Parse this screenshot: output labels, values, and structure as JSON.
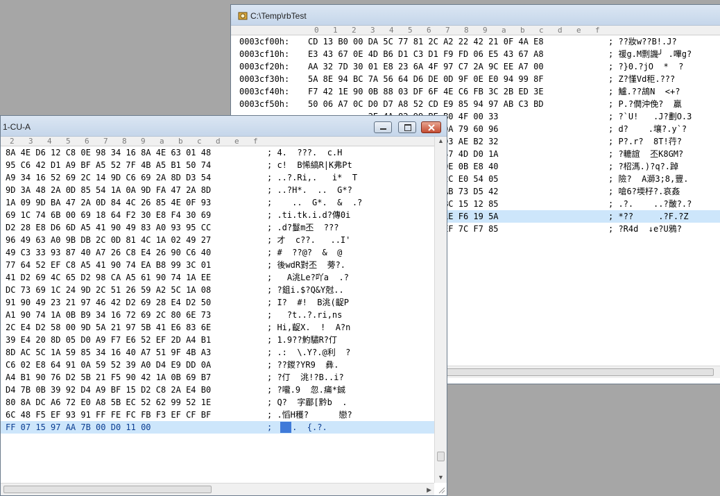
{
  "header_cols": [
    "0",
    "1",
    "2",
    "3",
    "4",
    "5",
    "6",
    "7",
    "8",
    "9",
    "a",
    "b",
    "c",
    "d",
    "e",
    "f"
  ],
  "back_window": {
    "title": "C:\\Temp\\rbTest",
    "rows": [
      {
        "off": "0003cf00h:",
        "hex": "CD 13 B0 00 DA 5C 77 81 2C A2 22 42 21 0F 4A E8",
        "txt": "; ??妝w??B!.J?"
      },
      {
        "off": "0003cf10h:",
        "hex": "E3 43 67 0E 4D B6 D1 C3 D1 F9 FD 06 E5 43 67 A8",
        "txt": "; 禐g.M剽譏╯ .嗶g?"
      },
      {
        "off": "0003cf20h:",
        "hex": "AA 32 7D 30 01 E8 23 6A 4F 97 C7 2A 9C EE A7 00",
        "txt": "; ?}0.?jO  *  ?"
      },
      {
        "off": "0003cf30h:",
        "hex": "5A 8E 94 BC 7A 56 64 D6 DE 0D 9F 0E E0 94 99 8F",
        "txt": "; Z?慬Vd秬.???"
      },
      {
        "off": "0003cf40h:",
        "hex": "F7 42 1E 90 0B 88 03 DF 6F 4E C6 FB 3C 2B ED 3E",
        "txt": "; 鱸.??鴣N  <+?"
      },
      {
        "off": "0003cf50h:",
        "hex": "50 06 A7 0C D0 D7 A8 52 CD E9 85 94 97 AB C3 BD",
        "txt": "; P.?僩沖俛?  贏"
      },
      {
        "off": "",
        "hex": "            2E 4A 82 99 BE B0 4F 00 33",
        "txt": "; ?`U!   .J?劃O.3"
      },
      {
        "off": "",
        "hex": "            11 E9 49 F5 23 0A 79 60 96",
        "txt": "; d?    .壤?.y`?"
      },
      {
        "off": "",
        "hex": "            00 B9 38 54 21 D3 AE B2 32",
        "txt": "; P?.r?  8T!荇?"
      },
      {
        "off": "",
        "hex": "            83 A5 41 4B 38 47 4D D0 1A",
        "txt": "; ?轆誼  丕K8GM?"
      },
      {
        "off": "",
        "hex": "            59 89 38 71 A1 0E 0B E8 40",
        "txt": "; ?柖溤.)?q?.踔"
      },
      {
        "off": "",
        "hex": "            A9 ED 33 3B 38 2C E0 54 05",
        "txt": "; 險?  A溮3;8,豐."
      },
      {
        "off": "",
        "hex": "            5D 45 86 04 1C AB 73 D5 42",
        "txt": "; 嗆6?堧杍?.哀姦"
      },
      {
        "off": "",
        "hex": "            10 CF 8E F0 52 BC 15 12 85",
        "txt": "; .?.    ..?皾?.?"
      },
      {
        "off": "",
        "hex": "            B0 15 ED 23 46 1E F6 19 5A",
        "txt": "; *??     .?F.?Z"
      },
      {
        "off": "",
        "hex": "            A7 65 E7 95 55 EF 7C F7 85",
        "txt": "; ?R4d  ↓e?U鴉?"
      }
    ]
  },
  "front_window": {
    "title": "1-CU-A",
    "header_cols": [
      "2",
      "3",
      "4",
      "5",
      "6",
      "7",
      "8",
      "9",
      "a",
      "b",
      "c",
      "d",
      "e",
      "f"
    ],
    "rows": [
      {
        "hex": "8A 4E D6 12 C8 0E 98 34 16 8A 4E 63 01 48",
        "txt": "; 4.  ???.  c.H"
      },
      {
        "hex": "95 C6 42 D1 A9 BF A5 52 7F 4B A5 B1 50 74",
        "txt": "; c!  B悕縞R|K弗Pt"
      },
      {
        "hex": "A9 34 16 52 69 2C 14 9D C6 69 2A 8D D3 54",
        "txt": "; ..?.Ri,.   i*  T"
      },
      {
        "hex": "9D 3A 48 2A 0D 85 54 1A 0A 9D FA 47 2A 8D",
        "txt": "; ..?H*.  ..  G*?"
      },
      {
        "hex": "1A 09 9D BA 47 2A 0D 84 4C 26 85 4E 0F 93",
        "txt": ";    ..  G*.  &  .?"
      },
      {
        "hex": "69 1C 74 6B 00 69 18 64 F2 30 E8 F4 30 69",
        "txt": "; .ti.tk.i.d?傳0i"
      },
      {
        "hex": "D2 28 E8 D6 6D A5 41 90 49 83 A0 93 95 CC",
        "txt": "; .d?鬘m丕  ???"
      },
      {
        "hex": "96 49 63 A0 9B DB 2C 0D 81 4C 1A 02 49 27",
        "txt": "; 才  c??.   ..I'"
      },
      {
        "hex": "49 C3 33 93 87 40 A7 26 C8 E4 26 90 C6 40",
        "txt": "; #  ??@?  &  @"
      },
      {
        "hex": "77 64 52 EF C8 A5 41 90 74 EA B8 99 3C 01",
        "txt": "; 後wdR對丕  蒡?."
      },
      {
        "hex": "41 D2 69 4C 65 D2 98 CA A5 61 90 74 1A EE",
        "txt": ";   A洮Le?吖a  .?"
      },
      {
        "hex": "DC 73 69 1C 24 9D 2C 51 26 59 A2 5C 1A 08",
        "txt": "; ?鉏i.$?Q&Y尅.."
      },
      {
        "hex": "91 90 49 23 21 97 46 42 D2 69 28 E4 D2 50",
        "txt": "; I?  #!  B洮(齪P"
      },
      {
        "hex": "A1 90 74 1A 0B B9 34 16 72 69 2C 80 6E 73",
        "txt": ";   ?t..?.ri,ns"
      },
      {
        "hex": "2C E4 D2 58 00 9D 5A 21 97 5B 41 E6 83 6E",
        "txt": "; Hi,齪X.  !  A?n"
      },
      {
        "hex": "39 E4 20 8D 05 D0 A9 F7 E6 52 EF 2D A4 B1",
        "txt": "; 1.9??魡驌R?仃"
      },
      {
        "hex": "8D AC 5C 1A 59 85 34 16 40 A7 51 9F 4B A3",
        "txt": "; .:  \\.Y?.@利  ?"
      },
      {
        "hex": "C6 02 E8 64 91 0A 59 52 39 A0 D4 E9 DD 0A",
        "txt": "; ??鍐?YR9  彝."
      },
      {
        "hex": "A4 B1 90 76 D2 5B 21 F5 90 42 1A 0B 69 B7",
        "txt": "; ?仃  洮!?B..i?"
      },
      {
        "hex": "D4 7B 0B 39 92 D4 A9 BF 15 D2 C8 2A E4 B0",
        "txt": "; ?嚨.9  忽.痡*鋮"
      },
      {
        "hex": "80 8A DC A6 72 E0 A8 5B EC 52 62 99 52 1E",
        "txt": "; Q?  字郿[黔b  ."
      },
      {
        "hex": "6C 48 F5 EF 93 91 FF FE FC FB F3 EF CF BF",
        "txt": "; .慆H穫?      戀?"
      },
      {
        "hex": "FF 07 15 97 AA 7B 00 D0 11 00",
        "txt": ";  ?..  {.?."
      }
    ]
  }
}
